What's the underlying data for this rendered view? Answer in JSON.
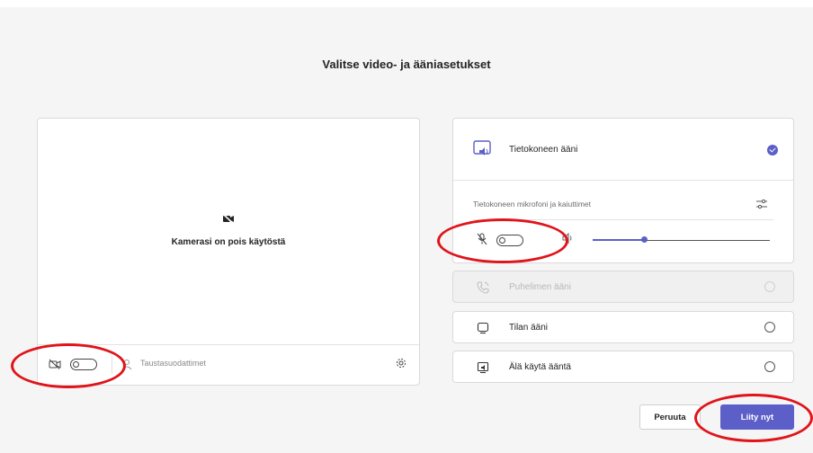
{
  "dialog": {
    "title": "Valitse video- ja ääniasetukset"
  },
  "video": {
    "camera_off_label": "Kamerasi on pois käytöstä",
    "camera_toggle_on": false,
    "background_filters_label": "Taustasuodattimet"
  },
  "audio": {
    "options": [
      {
        "label": "Tietokoneen ääni",
        "selected": true,
        "enabled": true
      },
      {
        "label": "Puhelimen ääni",
        "selected": false,
        "enabled": false
      },
      {
        "label": "Tilan ääni",
        "selected": false,
        "enabled": true
      },
      {
        "label": "Älä käytä ääntä",
        "selected": false,
        "enabled": true
      }
    ],
    "device_label": "Tietokoneen mikrofoni ja kaiuttimet",
    "mic_toggle_on": false,
    "volume_level": 0.29
  },
  "buttons": {
    "cancel": "Peruuta",
    "join": "Liity nyt"
  },
  "colors": {
    "accent": "#5b5fc7",
    "annotation": "#e0141a"
  },
  "icons": [
    "camera-off-icon",
    "background-filters-icon",
    "settings-icon",
    "computer-audio-icon",
    "checkmark-icon",
    "device-settings-icon",
    "mic-off-icon",
    "speaker-icon",
    "phone-audio-icon",
    "room-audio-icon",
    "no-audio-icon"
  ]
}
